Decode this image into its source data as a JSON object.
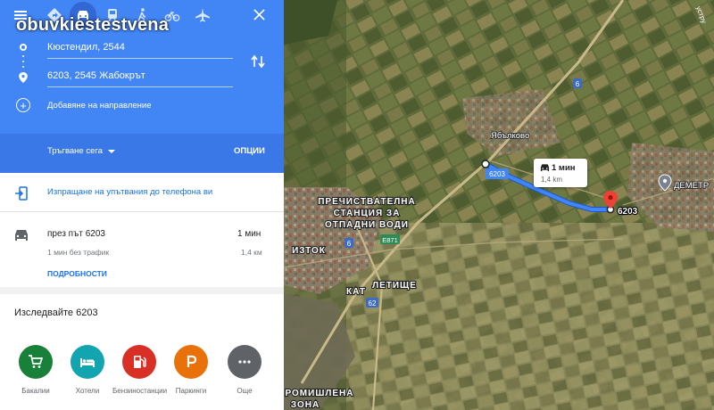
{
  "watermark": "obuvkiestestvena",
  "transport_modes": [
    "menu-icon",
    "directions-icon",
    "car-icon",
    "train-icon",
    "walk-icon",
    "bike-icon",
    "flight-icon"
  ],
  "origin": {
    "value": "Кюстендил, 2544"
  },
  "destination": {
    "value": "6203, 2545 Жабокрът"
  },
  "add_destination_label": "Добавяне на направление",
  "depart_label": "Тръгване сега",
  "options_label": "ОПЦИИ",
  "send_to_phone_label": "Изпращане на упътвания до телефона ви",
  "route": {
    "via": "през път 6203",
    "duration": "1 мин",
    "no_traffic": "1 мин без трафик",
    "distance": "1,4 км",
    "details_label": "ПОДРОБНОСТИ"
  },
  "explore_title": "Изследвайте 6203",
  "categories": [
    {
      "label": "Бакалии",
      "color": "#188038",
      "icon": "cart-icon"
    },
    {
      "label": "Хотели",
      "color": "#12a4af",
      "icon": "bed-icon"
    },
    {
      "label": "Бензиностанции",
      "color": "#d93025",
      "icon": "fuel-icon"
    },
    {
      "label": "Паркинги",
      "color": "#e8710a",
      "icon": "parking-icon"
    },
    {
      "label": "Още",
      "color": "#5f6368",
      "icon": "more-icon"
    }
  ],
  "map": {
    "road_label_6203": "6203",
    "route_box_duration": "1 мин",
    "route_box_distance": "1,4 km",
    "dest_label": "6203",
    "village_label": "Ябълково",
    "place_dimitr": "ДЕМЕТР",
    "place_station": [
      "ПРЕЧИСТВАТЕЛНА",
      "СТАНЦИЯ ЗА",
      "ОТПАДНИ ВОДИ"
    ],
    "place_iztok": "ИЗТОК",
    "place_kat": "КАТ",
    "place_letishte": "ЛЕТИЩЕ",
    "place_industrial": [
      "РОМИШЛЕНА",
      "ЗОНА"
    ],
    "road_badge_6": "6",
    "road_badge_62": "62",
    "road_badge_e871": "E871",
    "top_right_fragment": "устру",
    "colors": {
      "route": "#4285f4",
      "accent": "#4285f4",
      "pin": "#ea4335"
    }
  }
}
